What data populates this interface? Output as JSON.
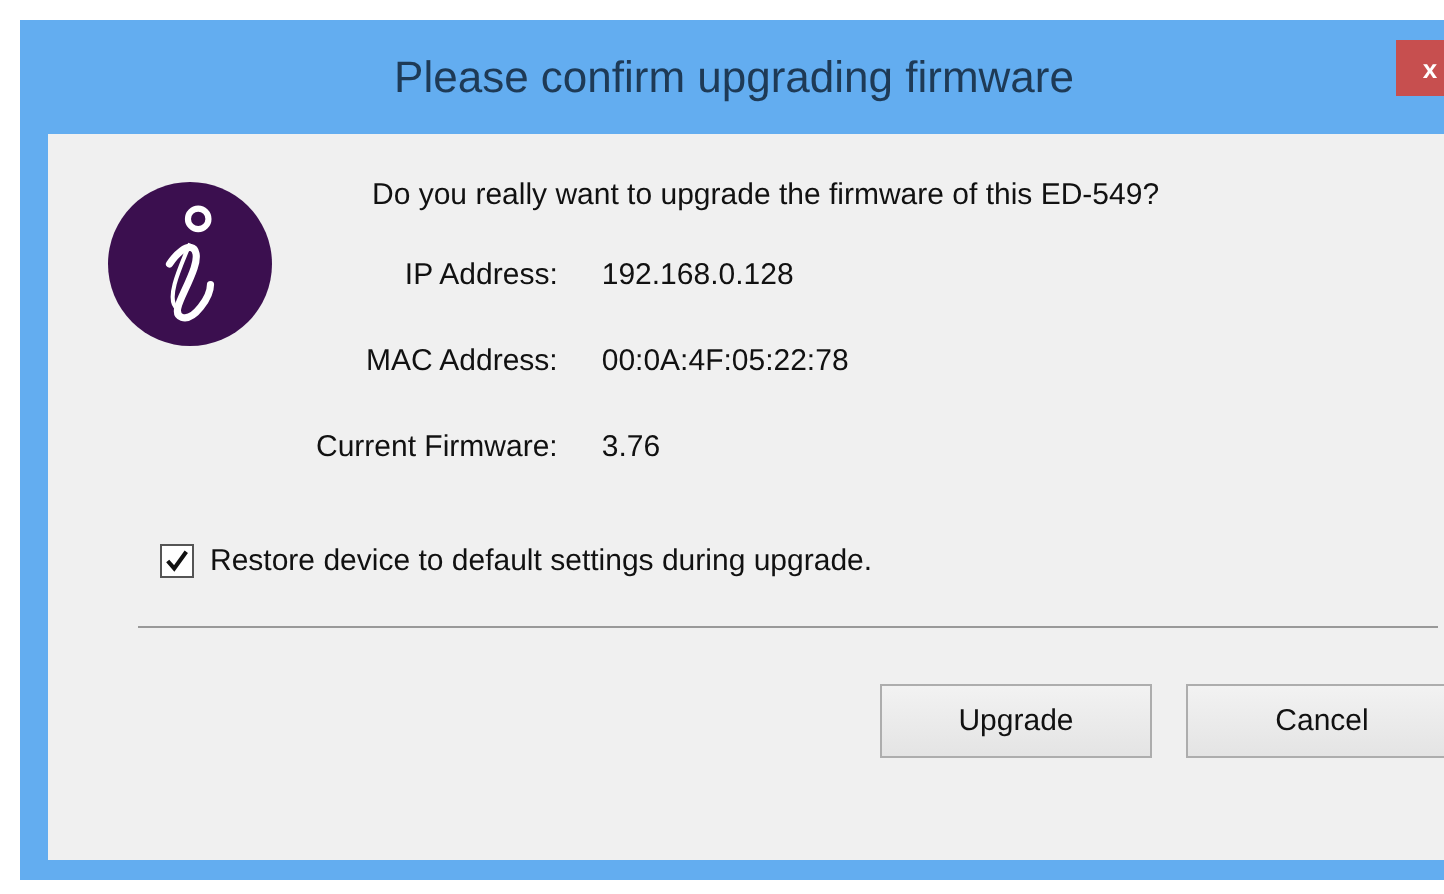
{
  "window": {
    "title": "Please confirm upgrading firmware",
    "close": "x"
  },
  "message": "Do you really want to upgrade the firmware of this ED-549?",
  "fields": [
    {
      "label": "IP Address:",
      "value": "192.168.0.128"
    },
    {
      "label": "MAC Address:",
      "value": "00:0A:4F:05:22:78"
    },
    {
      "label": "Current Firmware:",
      "value": "3.76"
    }
  ],
  "restore_option": {
    "label": "Restore device to default settings during upgrade.",
    "checked": true
  },
  "buttons": [
    "Upgrade",
    "Cancel"
  ]
}
